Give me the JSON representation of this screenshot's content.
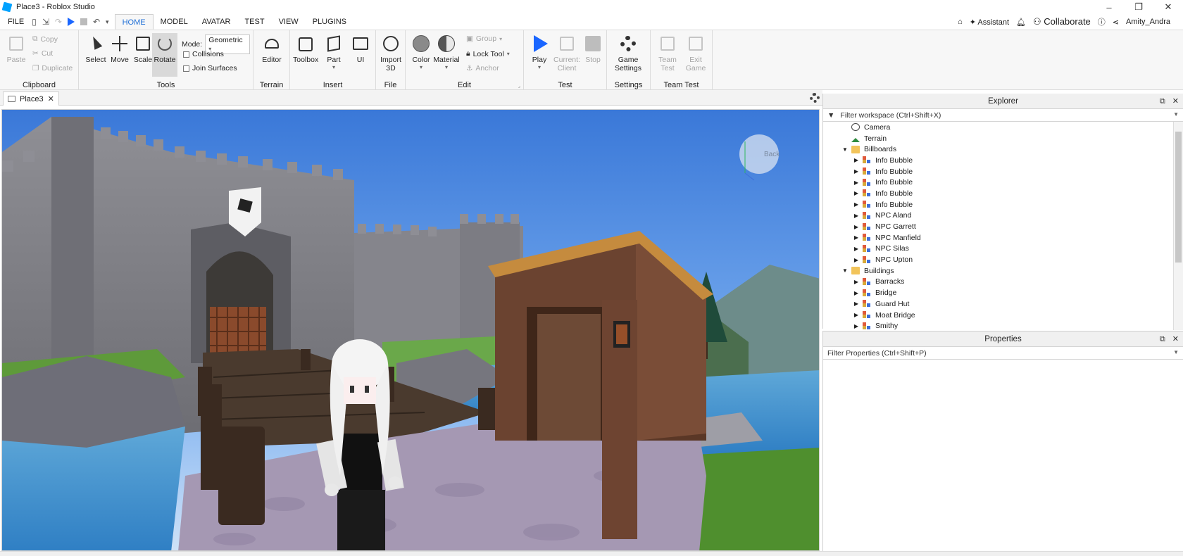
{
  "window": {
    "title": "Place3 - Roblox Studio",
    "controls": [
      "–",
      "❐",
      "✕"
    ]
  },
  "menu": {
    "file": "FILE",
    "tabs": [
      "HOME",
      "MODEL",
      "AVATAR",
      "TEST",
      "VIEW",
      "PLUGINS"
    ],
    "active_tab": "HOME",
    "right": {
      "assistant": "Assistant",
      "collaborate": "Collaborate",
      "user": "Amity_Andra"
    }
  },
  "ribbon": {
    "clipboard": {
      "label": "Clipboard",
      "paste": "Paste",
      "copy": "Copy",
      "cut": "Cut",
      "duplicate": "Duplicate"
    },
    "tools": {
      "label": "Tools",
      "select": "Select",
      "move": "Move",
      "scale": "Scale",
      "rotate": "Rotate",
      "mode_label": "Mode:",
      "mode_value": "Geometric",
      "collisions": "Collisions",
      "join_surfaces": "Join Surfaces"
    },
    "terrain": {
      "label": "Terrain",
      "editor": "Editor"
    },
    "insert": {
      "label": "Insert",
      "toolbox": "Toolbox",
      "part": "Part",
      "ui": "UI"
    },
    "file": {
      "label": "File",
      "import_line1": "Import",
      "import_line2": "3D"
    },
    "edit": {
      "label": "Edit",
      "color": "Color",
      "material": "Material",
      "group": "Group",
      "lock_tool": "Lock Tool",
      "anchor": "Anchor"
    },
    "test": {
      "label": "Test",
      "play": "Play",
      "current_line1": "Current:",
      "current_line2": "Client",
      "stop": "Stop"
    },
    "settings": {
      "label": "Settings",
      "game_line1": "Game",
      "game_line2": "Settings"
    },
    "team_test": {
      "label": "Team Test",
      "team_line1": "Team",
      "team_line2": "Test",
      "exit_line1": "Exit",
      "exit_line2": "Game"
    }
  },
  "document_tab": {
    "name": "Place3",
    "close": "✕"
  },
  "viewport": {
    "view_cube_label": "Back"
  },
  "explorer": {
    "title": "Explorer",
    "filter_placeholder": "Filter workspace (Ctrl+Shift+X)",
    "items": [
      {
        "label": "Camera",
        "icon": "camera-icon",
        "depth": 1,
        "expander": ""
      },
      {
        "label": "Terrain",
        "icon": "terrain-icon",
        "depth": 1,
        "expander": ""
      },
      {
        "label": "Billboards",
        "icon": "folder-icon",
        "depth": 1,
        "expander": "▼"
      },
      {
        "label": "Info Bubble",
        "icon": "model-icon",
        "depth": 2,
        "expander": "▶"
      },
      {
        "label": "Info Bubble",
        "icon": "model-icon",
        "depth": 2,
        "expander": "▶"
      },
      {
        "label": "Info Bubble",
        "icon": "model-icon",
        "depth": 2,
        "expander": "▶"
      },
      {
        "label": "Info Bubble",
        "icon": "model-icon",
        "depth": 2,
        "expander": "▶"
      },
      {
        "label": "Info Bubble",
        "icon": "model-icon",
        "depth": 2,
        "expander": "▶"
      },
      {
        "label": "NPC Aland",
        "icon": "model-icon",
        "depth": 2,
        "expander": "▶"
      },
      {
        "label": "NPC Garrett",
        "icon": "model-icon",
        "depth": 2,
        "expander": "▶"
      },
      {
        "label": "NPC Manfield",
        "icon": "model-icon",
        "depth": 2,
        "expander": "▶"
      },
      {
        "label": "NPC Silas",
        "icon": "model-icon",
        "depth": 2,
        "expander": "▶"
      },
      {
        "label": "NPC Upton",
        "icon": "model-icon",
        "depth": 2,
        "expander": "▶"
      },
      {
        "label": "Buildings",
        "icon": "folder-icon",
        "depth": 1,
        "expander": "▼"
      },
      {
        "label": "Barracks",
        "icon": "model-icon",
        "depth": 2,
        "expander": "▶"
      },
      {
        "label": "Bridge",
        "icon": "model-icon",
        "depth": 2,
        "expander": "▶"
      },
      {
        "label": "Guard Hut",
        "icon": "model-icon",
        "depth": 2,
        "expander": "▶"
      },
      {
        "label": "Moat Bridge",
        "icon": "model-icon",
        "depth": 2,
        "expander": "▶"
      },
      {
        "label": "Smithy",
        "icon": "model-icon",
        "depth": 2,
        "expander": "▶"
      }
    ]
  },
  "properties": {
    "title": "Properties",
    "filter_placeholder": "Filter Properties (Ctrl+Shift+P)"
  }
}
